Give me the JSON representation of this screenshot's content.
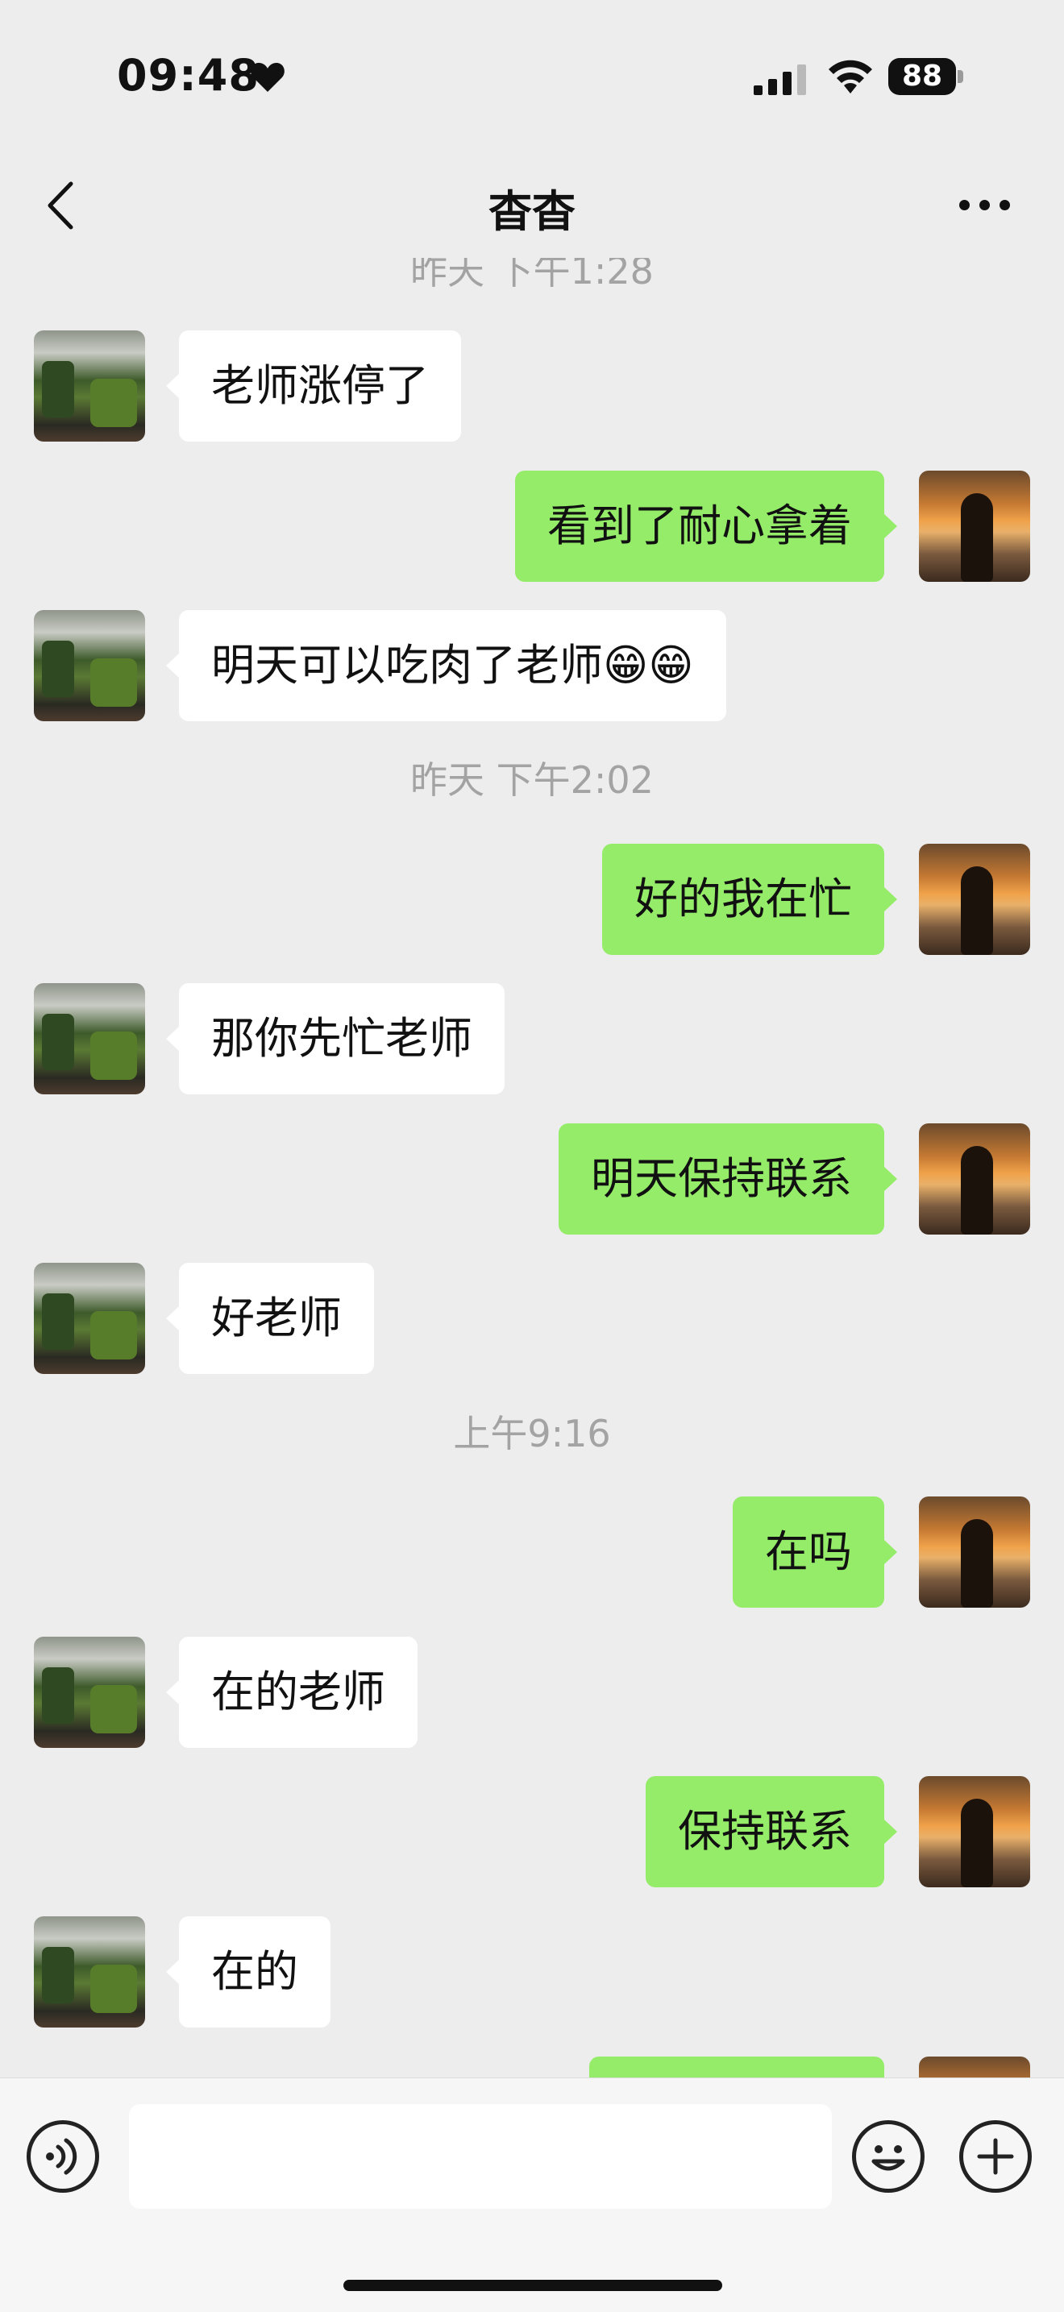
{
  "status_bar": {
    "time": "09:48",
    "battery": "88"
  },
  "nav": {
    "title": "杳杳"
  },
  "messages": [
    {
      "kind": "timestamp",
      "text": "昨天 下午1:28"
    },
    {
      "kind": "in",
      "text": "老师涨停了"
    },
    {
      "kind": "out",
      "text": "看到了耐心拿着"
    },
    {
      "kind": "in",
      "text": "明天可以吃肉了老师😁😁"
    },
    {
      "kind": "timestamp",
      "text": "昨天 下午2:02"
    },
    {
      "kind": "out",
      "text": "好的我在忙"
    },
    {
      "kind": "in",
      "text": "那你先忙老师"
    },
    {
      "kind": "out",
      "text": "明天保持联系"
    },
    {
      "kind": "in",
      "text": "好老师"
    },
    {
      "kind": "timestamp",
      "text": "上午9:16"
    },
    {
      "kind": "out",
      "text": "在吗"
    },
    {
      "kind": "in",
      "text": "在的老师"
    },
    {
      "kind": "out",
      "text": "保持联系"
    },
    {
      "kind": "in",
      "text": "在的"
    },
    {
      "kind": "out",
      "text": ""
    }
  ],
  "input": {
    "value": ""
  },
  "colors": {
    "background": "#ededed",
    "outgoing_bubble": "#95ec69",
    "incoming_bubble": "#ffffff",
    "timestamp_text": "#a3a3a3"
  },
  "icons": [
    "heart-icon",
    "signal-icon",
    "wifi-icon",
    "battery-icon",
    "back-icon",
    "more-icon",
    "voice-icon",
    "emoji-icon",
    "plus-icon"
  ]
}
